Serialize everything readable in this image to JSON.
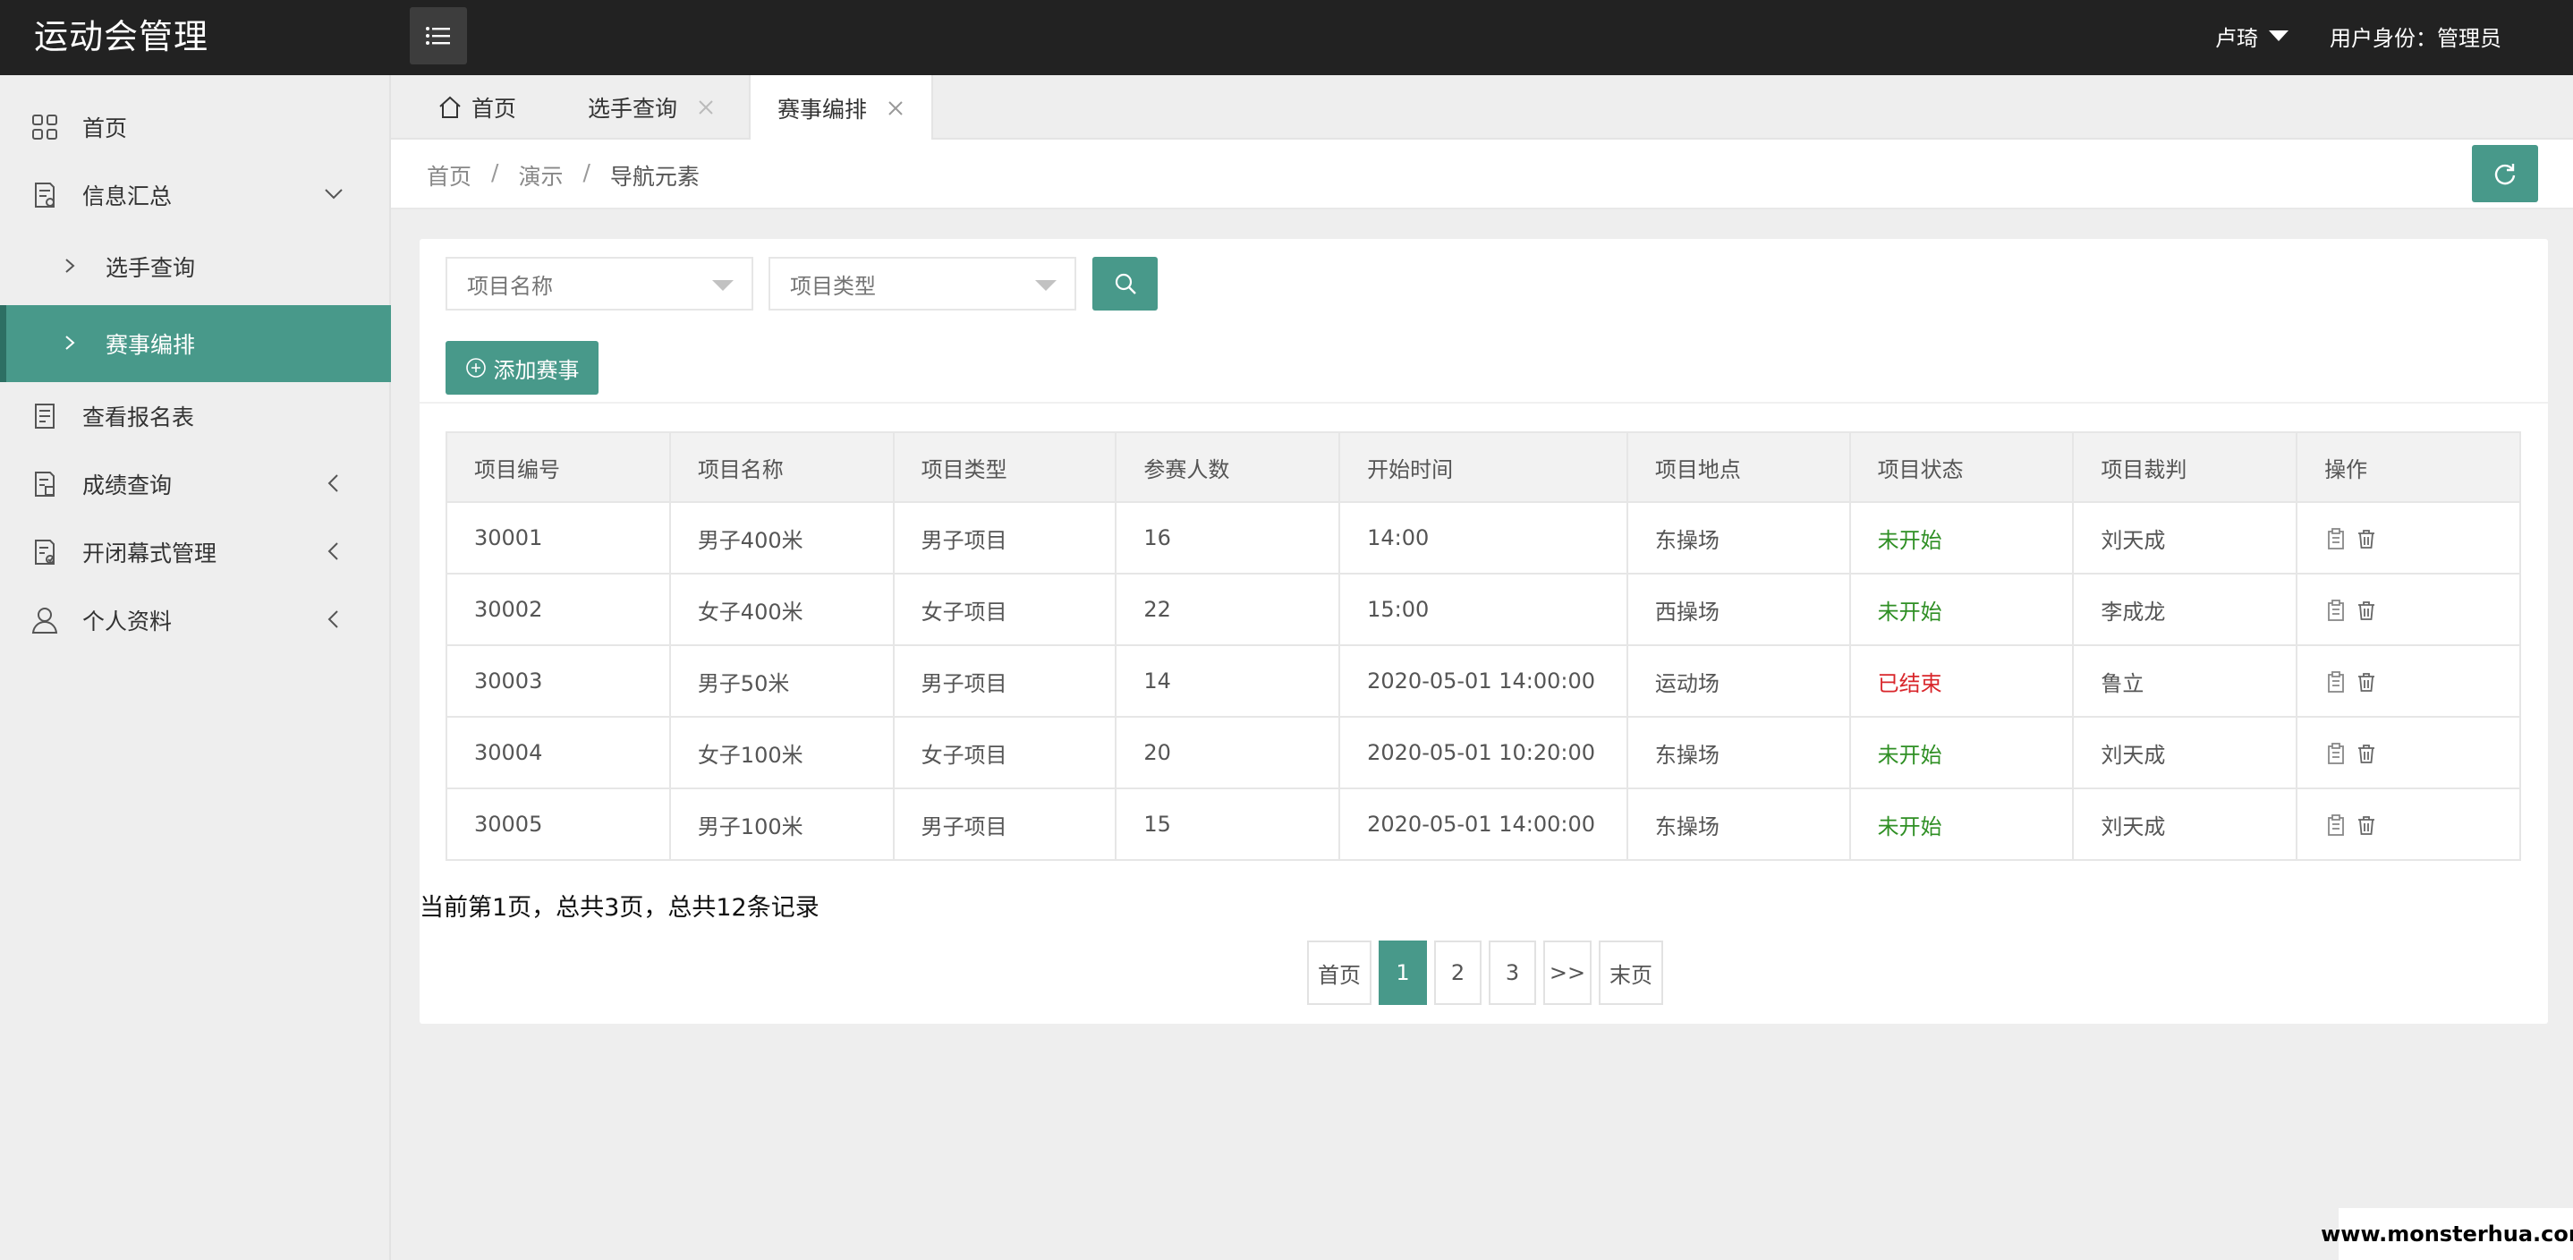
{
  "header": {
    "app_title": "运动会管理",
    "user_name": "卢琦",
    "user_role": "用户身份：管理员"
  },
  "sidebar": {
    "items": [
      {
        "label": "首页",
        "icon": "grid-icon"
      },
      {
        "label": "信息汇总",
        "icon": "document-icon",
        "expanded": true
      },
      {
        "label": "选手查询",
        "sub": true
      },
      {
        "label": "赛事编排",
        "sub": true,
        "active": true
      },
      {
        "label": "查看报名表",
        "icon": "form-icon"
      },
      {
        "label": "成绩查询",
        "icon": "report-icon"
      },
      {
        "label": "开闭幕式管理",
        "icon": "checklist-icon"
      },
      {
        "label": "个人资料",
        "icon": "user-icon"
      }
    ]
  },
  "tabs": [
    {
      "label": "首页",
      "icon": "home-icon"
    },
    {
      "label": "选手查询",
      "closable": true
    },
    {
      "label": "赛事编排",
      "closable": true,
      "active": true
    }
  ],
  "breadcrumb": {
    "items": [
      "首页",
      "演示",
      "导航元素"
    ],
    "separator": "/"
  },
  "filters": {
    "name_placeholder": "项目名称",
    "type_placeholder": "项目类型",
    "add_label": "添加赛事"
  },
  "table": {
    "headers": [
      "项目编号",
      "项目名称",
      "项目类型",
      "参赛人数",
      "开始时间",
      "项目地点",
      "项目状态",
      "项目裁判",
      "操作"
    ],
    "rows": [
      [
        "30001",
        "男子400米",
        "男子项目",
        "16",
        "14:00",
        "东操场",
        "未开始",
        "刘天成"
      ],
      [
        "30002",
        "女子400米",
        "女子项目",
        "22",
        "15:00",
        "西操场",
        "未开始",
        "李成龙"
      ],
      [
        "30003",
        "男子50米",
        "男子项目",
        "14",
        "2020-05-01 14:00:00",
        "运动场",
        "已结束",
        "鲁立"
      ],
      [
        "30004",
        "女子100米",
        "女子项目",
        "20",
        "2020-05-01 10:20:00",
        "东操场",
        "未开始",
        "刘天成"
      ],
      [
        "30005",
        "男子100米",
        "男子项目",
        "15",
        "2020-05-01 14:00:00",
        "东操场",
        "未开始",
        "刘天成"
      ]
    ],
    "status_colors": {
      "未开始": "#2f8f24",
      "已结束": "#d9262b"
    }
  },
  "pagination": {
    "summary": "当前第1页，总共3页，总共12条记录",
    "first": "首页",
    "pages": [
      "1",
      "2",
      "3"
    ],
    "current": "1",
    "next": ">>",
    "last": "末页"
  },
  "theme": {
    "accent": "#48998a",
    "header_bg": "#222222",
    "sidebar_bg": "#eeeeee"
  },
  "watermark": "www.monsterhua.com"
}
